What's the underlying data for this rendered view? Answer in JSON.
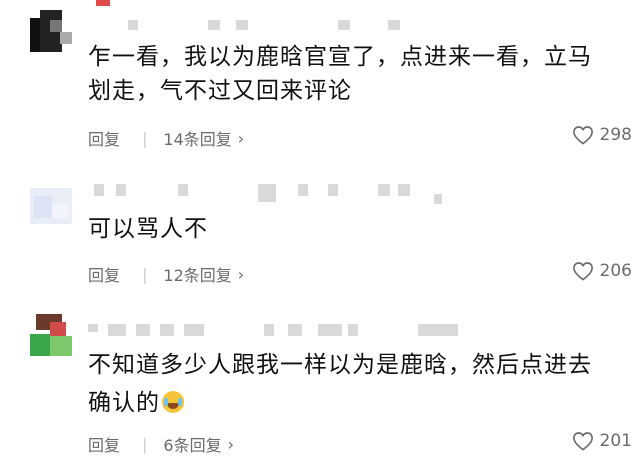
{
  "comments": [
    {
      "text_line1": "乍一看，我以为鹿晗官宣了，点进来一看，立马",
      "text_line2": "划走，气不过又回来评论",
      "reply_label": "回复",
      "reply_count": "14条回复",
      "chevron": "›",
      "likes": "298"
    },
    {
      "text_line1": "可以骂人不",
      "reply_label": "回复",
      "reply_count": "12条回复",
      "chevron": "›",
      "likes": "206"
    },
    {
      "text_line1": "不知道多少人跟我一样以为是鹿晗，然后点进去",
      "text_line2": "确认的",
      "emoji": "crying-laughing-emoji",
      "reply_label": "回复",
      "reply_count": "6条回复",
      "chevron": "›",
      "likes": "201"
    }
  ],
  "separator": "|",
  "icons": {
    "like": "heart-icon",
    "avatar": "pixelated-avatar"
  },
  "colors": {
    "text": "#111111",
    "meta": "#6b6b6b",
    "placeholder": "#d9d9d9"
  }
}
